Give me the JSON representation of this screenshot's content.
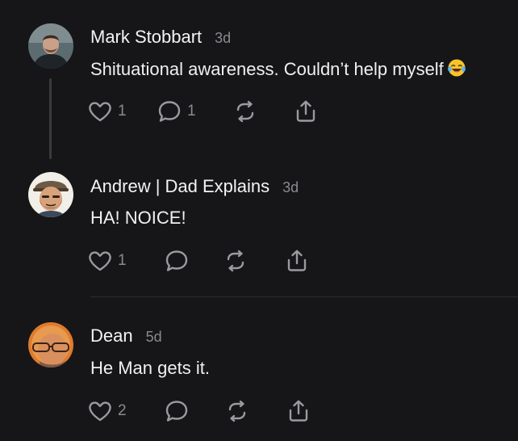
{
  "comments": [
    {
      "author": "Mark Stobbart",
      "time": "3d",
      "text": "Shituational awareness. Couldn’t help myself",
      "likes": "1",
      "replies": "1"
    },
    {
      "author": "Andrew | Dad Explains",
      "time": "3d",
      "text": "HA! NOICE!",
      "likes": "1",
      "replies": ""
    },
    {
      "author": "Dean",
      "time": "5d",
      "text": "He Man gets it.",
      "likes": "2",
      "replies": ""
    }
  ],
  "icons": {
    "like": "heart-icon",
    "reply": "speech-bubble-icon",
    "repost": "repost-icon",
    "share": "share-icon",
    "emoji": "laughing-tears-emoji"
  },
  "colors": {
    "background": "#161618",
    "text": "#f0f0f0",
    "muted": "#8a8a8f",
    "icon": "#9a9a9f",
    "divider": "#2c2c2f"
  }
}
